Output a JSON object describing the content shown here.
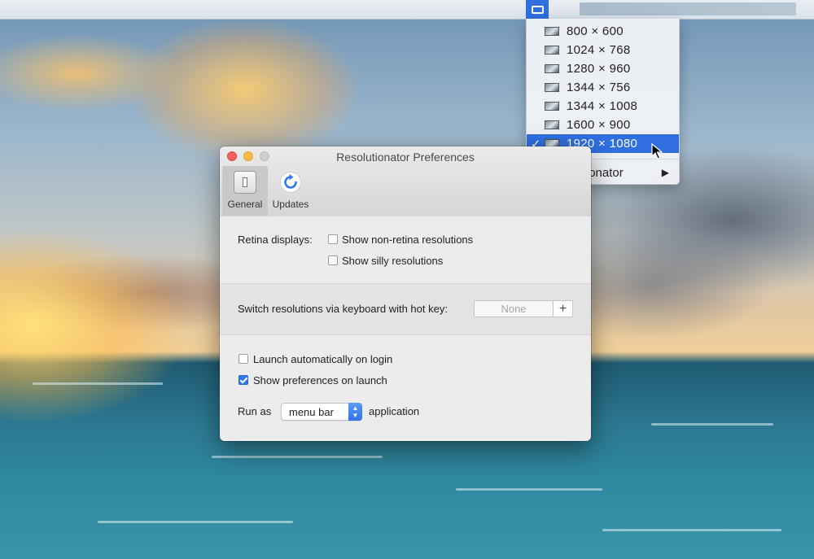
{
  "menu_dropdown": {
    "resolutions": [
      {
        "label": "800 × 600",
        "checked": false
      },
      {
        "label": "1024 × 768",
        "checked": false
      },
      {
        "label": "1280 × 960",
        "checked": false
      },
      {
        "label": "1344 × 756",
        "checked": false
      },
      {
        "label": "1344 × 1008",
        "checked": false
      },
      {
        "label": "1600 × 900",
        "checked": false
      },
      {
        "label": "1920 × 1080",
        "checked": true
      }
    ],
    "check_mark": "✓",
    "submenu_label": "Resolutionator",
    "submenu_arrow": "▶"
  },
  "window": {
    "title": "Resolutionator Preferences",
    "tabs": [
      {
        "label": "General",
        "icon": "general-icon",
        "selected": true
      },
      {
        "label": "Updates",
        "icon": "refresh-icon",
        "selected": false
      }
    ]
  },
  "general": {
    "retina_label": "Retina displays:",
    "show_non_retina": {
      "label": "Show non-retina resolutions",
      "checked": false
    },
    "show_silly": {
      "label": "Show silly resolutions",
      "checked": false
    },
    "hotkey_label": "Switch resolutions via keyboard with hot key:",
    "hotkey_value": "None",
    "hotkey_add": "+",
    "launch_login": {
      "label": "Launch automatically on login",
      "checked": false
    },
    "show_prefs": {
      "label": "Show preferences on launch",
      "checked": true
    },
    "run_as_label": "Run as",
    "run_as_value": "menu bar",
    "run_as_suffix": "application"
  },
  "colors": {
    "accent": "#2f6fe0",
    "close": "#fc605c",
    "minimize": "#fdbc40",
    "checkbox_checked": "#2f78f0"
  }
}
